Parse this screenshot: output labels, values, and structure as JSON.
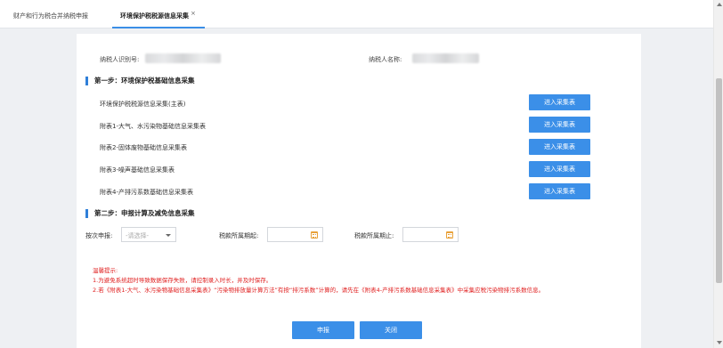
{
  "tabs": [
    {
      "label": "财产和行为税合并纳税申报"
    },
    {
      "label": "环境保护税税源信息采集",
      "close": "×"
    }
  ],
  "taxpayer": {
    "id_label": "纳税人识别号:",
    "name_label": "纳税人名称:"
  },
  "step1": {
    "title": "第一步：环境保护税基础信息采集",
    "rows": [
      {
        "label": "环境保护税税源信息采集(主表)",
        "button": "进入采集表"
      },
      {
        "label": "附表1-大气、水污染物基础信息采集表",
        "button": "进入采集表"
      },
      {
        "label": "附表2-固体废物基础信息采集表",
        "button": "进入采集表"
      },
      {
        "label": "附表3-噪声基础信息采集表",
        "button": "进入采集表"
      },
      {
        "label": "附表4-产排污系数基础信息采集表",
        "button": "进入采集表"
      }
    ]
  },
  "step2": {
    "title": "第二步：申报计算及减免信息采集",
    "per_time_label": "按次申报:",
    "per_time_placeholder": "-请选择-",
    "period_start_label": "税款所属期起:",
    "period_end_label": "税款所属期止:"
  },
  "tips": {
    "title": "温馨提示:",
    "line1": "1.为避免系统超时导致数据保存失败，请控制录入时长，并及时保存。",
    "line2": "2.若《附表1-大气、水污染物基础信息采集表》“污染物排放量计算方法”有按“排污系数”计算的，请先在《附表4-产排污系数基础信息采集表》中采集应税污染物排污系数信息。"
  },
  "actions": {
    "submit": "申报",
    "close": "关闭"
  },
  "colors": {
    "accent": "#3b8fe8",
    "warning": "#e02020",
    "calendar_icon": "#e8a13a"
  }
}
